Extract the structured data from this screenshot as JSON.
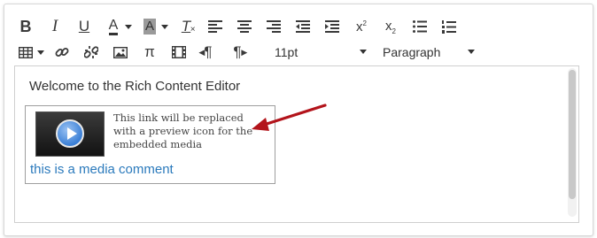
{
  "toolbar": {
    "row1": [
      {
        "name": "bold-button",
        "icon": "bold-icon"
      },
      {
        "name": "italic-button",
        "icon": "italic-icon"
      },
      {
        "name": "underline-button",
        "icon": "underline-icon"
      },
      {
        "name": "text-color-button",
        "icon": "text-color-icon"
      },
      {
        "name": "background-color-button",
        "icon": "background-color-icon"
      },
      {
        "name": "clear-formatting-button",
        "icon": "clear-formatting-icon"
      },
      {
        "name": "align-left-button",
        "icon": "align-left-icon"
      },
      {
        "name": "align-center-button",
        "icon": "align-center-icon"
      },
      {
        "name": "align-right-button",
        "icon": "align-right-icon"
      },
      {
        "name": "outdent-button",
        "icon": "outdent-icon"
      },
      {
        "name": "indent-button",
        "icon": "indent-icon"
      },
      {
        "name": "superscript-button",
        "icon": "superscript-icon"
      },
      {
        "name": "subscript-button",
        "icon": "subscript-icon"
      },
      {
        "name": "bullet-list-button",
        "icon": "bullet-list-icon"
      },
      {
        "name": "numbered-list-button",
        "icon": "numbered-list-icon"
      }
    ],
    "row2": [
      {
        "name": "table-button",
        "icon": "table-icon"
      },
      {
        "name": "link-button",
        "icon": "link-icon"
      },
      {
        "name": "unlink-button",
        "icon": "unlink-icon"
      },
      {
        "name": "image-button",
        "icon": "image-icon"
      },
      {
        "name": "equation-button",
        "icon": "pi-icon"
      },
      {
        "name": "media-button",
        "icon": "film-icon"
      },
      {
        "name": "ltr-button",
        "icon": "paragraph-ltr-icon"
      },
      {
        "name": "rtl-button",
        "icon": "paragraph-rtl-icon"
      }
    ],
    "glyphs": {
      "bold": "B",
      "italic": "I",
      "underline": "U",
      "text_color": "A",
      "bg_color": "A",
      "clear": "T",
      "superscript": "x",
      "subscript": "x",
      "sup_mark": "2",
      "sub_mark": "2",
      "pi": "π",
      "pilcrow": "¶"
    },
    "font_size": "11pt",
    "block_format": "Paragraph"
  },
  "editor": {
    "welcome_text": "Welcome to the Rich Content Editor",
    "media_note": "This link will be replaced with a preview icon for the embedded media",
    "media_link": "this is a media comment"
  },
  "colors": {
    "link": "#2b7abc",
    "arrow": "#b3141b",
    "play_button": "#3a7fd6"
  }
}
